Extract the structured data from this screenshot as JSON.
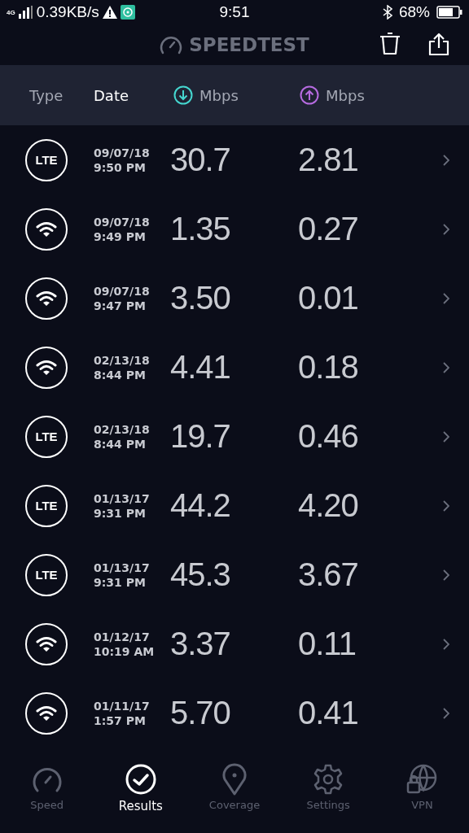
{
  "status_bar": {
    "network": "4G",
    "speed": "0.39KB/s",
    "time": "9:51",
    "battery": "68%"
  },
  "header": {
    "title": "SPEEDTEST"
  },
  "columns": {
    "type": "Type",
    "date": "Date",
    "download": "Mbps",
    "upload": "Mbps"
  },
  "results": [
    {
      "kind": "lte",
      "badge": "LTE",
      "date": "09/07/18",
      "time": "9:50 PM",
      "download": "30.7",
      "upload": "2.81"
    },
    {
      "kind": "wifi",
      "date": "09/07/18",
      "time": "9:49 PM",
      "download": "1.35",
      "upload": "0.27"
    },
    {
      "kind": "wifi",
      "date": "09/07/18",
      "time": "9:47 PM",
      "download": "3.50",
      "upload": "0.01"
    },
    {
      "kind": "wifi",
      "date": "02/13/18",
      "time": "8:44 PM",
      "download": "4.41",
      "upload": "0.18"
    },
    {
      "kind": "lte",
      "badge": "LTE",
      "date": "02/13/18",
      "time": "8:44 PM",
      "download": "19.7",
      "upload": "0.46"
    },
    {
      "kind": "lte",
      "badge": "LTE",
      "date": "01/13/17",
      "time": "9:31 PM",
      "download": "44.2",
      "upload": "4.20"
    },
    {
      "kind": "lte",
      "badge": "LTE",
      "date": "01/13/17",
      "time": "9:31 PM",
      "download": "45.3",
      "upload": "3.67"
    },
    {
      "kind": "wifi",
      "date": "01/12/17",
      "time": "10:19 AM",
      "download": "3.37",
      "upload": "0.11"
    },
    {
      "kind": "wifi",
      "date": "01/11/17",
      "time": "1:57 PM",
      "download": "5.70",
      "upload": "0.41"
    }
  ],
  "nav": [
    {
      "kind": "speed",
      "label": "Speed",
      "selected": false
    },
    {
      "kind": "results",
      "label": "Results",
      "selected": true
    },
    {
      "kind": "coverage",
      "label": "Coverage",
      "selected": false
    },
    {
      "kind": "settings",
      "label": "Settings",
      "selected": false
    },
    {
      "kind": "vpn",
      "label": "VPN",
      "selected": false
    }
  ]
}
